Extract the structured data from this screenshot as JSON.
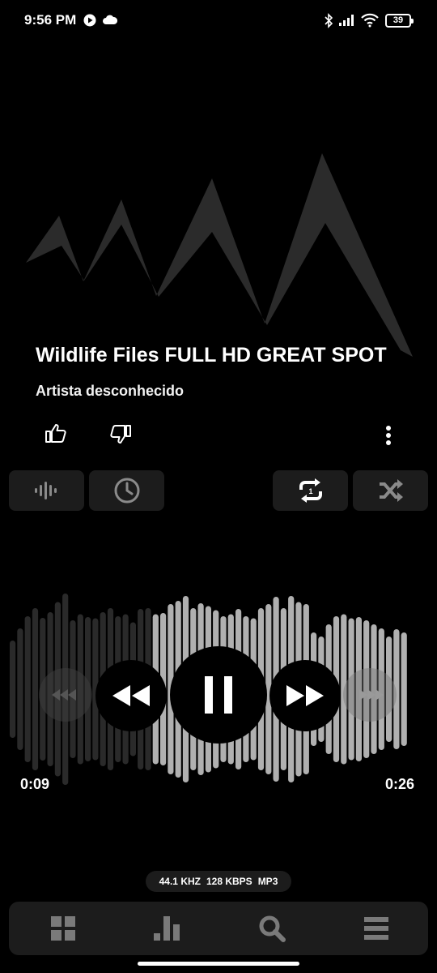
{
  "status_bar": {
    "time": "9:56 PM",
    "battery": "39",
    "icons": [
      "play-circle-icon",
      "cloud-icon",
      "bluetooth-icon",
      "signal-icon",
      "wifi-icon",
      "battery-icon"
    ]
  },
  "track": {
    "title": "Wildlife Files FULL HD GREAT SPOT",
    "artist": "Artista desconhecido"
  },
  "actions": {
    "like_icon": "thumb-up-icon",
    "dislike_icon": "thumb-down-icon",
    "more_icon": "more-vertical-icon"
  },
  "toolbar": {
    "left": [
      "equalizer-icon",
      "sleep-timer-icon"
    ],
    "right": [
      "repeat-one-icon",
      "shuffle-icon"
    ]
  },
  "playback": {
    "elapsed": "0:09",
    "duration": "0:26",
    "progress_fraction": 0.35
  },
  "controls": [
    "seek-back-icon",
    "rewind-icon",
    "pause-icon",
    "fast-forward-icon",
    "seek-forward-icon"
  ],
  "format": {
    "sample_rate": "44.1 KHZ",
    "bitrate": "128 KBPS",
    "codec": "MP3"
  },
  "bottom_nav": [
    "grid-icon",
    "bar-chart-icon",
    "search-icon",
    "menu-icon"
  ],
  "colors": {
    "background": "#000000",
    "surface": "#1c1c1c",
    "played_wave": "#2a2a2a",
    "unplayed_wave": "#b0b0b0",
    "accent": "#ffffff"
  }
}
